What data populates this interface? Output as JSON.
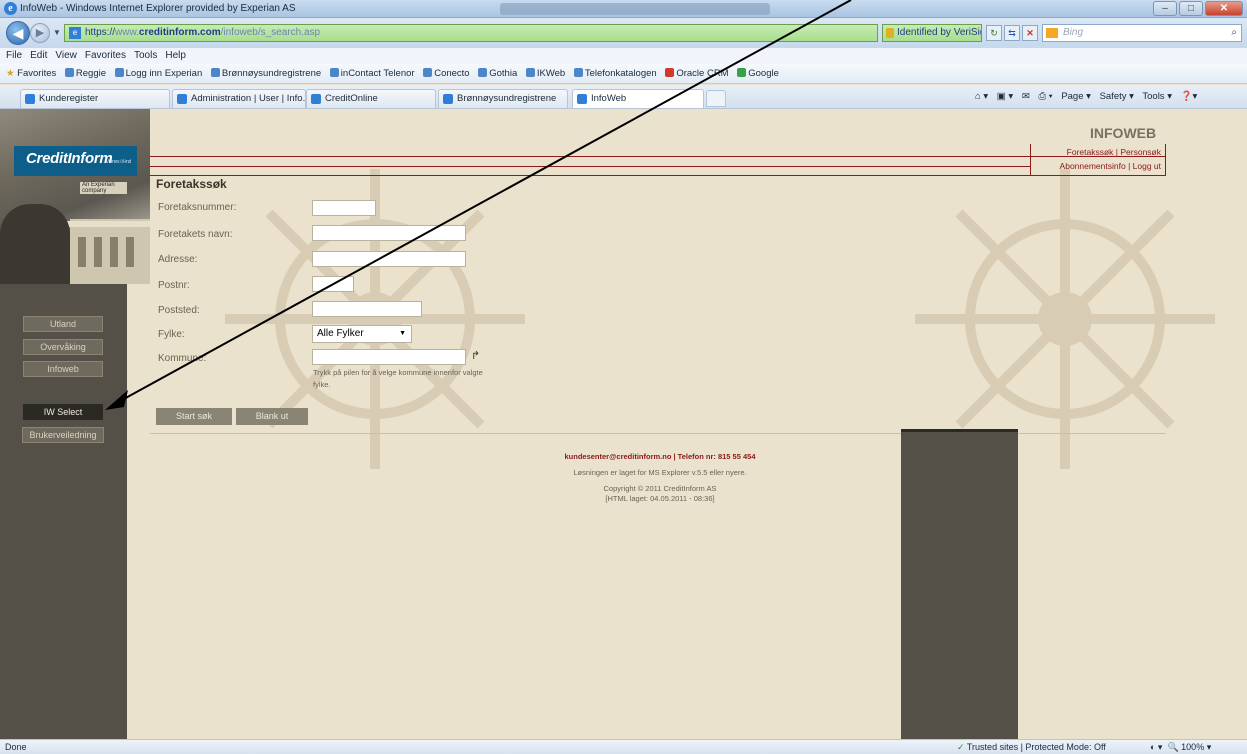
{
  "window": {
    "title": "InfoWeb - Windows Internet Explorer provided by Experian AS"
  },
  "address": {
    "url_prefix": "https://",
    "url_host_dim": "www.",
    "url_host": "creditinform.com",
    "url_path": "/infoweb/s_search.asp",
    "identity": "Identified by VeriSign",
    "search_placeholder": "Bing"
  },
  "menu": [
    "File",
    "Edit",
    "View",
    "Favorites",
    "Tools",
    "Help"
  ],
  "favorites": {
    "label": "Favorites",
    "items": [
      "Reggie",
      "Logg inn Experian",
      "Brønnøysundregistrene",
      "inContact Telenor",
      "Conecto",
      "Gothia",
      "IKWeb",
      "Telefonkatalogen",
      "Oracle CRM",
      "Google"
    ]
  },
  "tabs": [
    "Kunderegister",
    "Administration | User | Info...",
    "CreditOnline",
    "Brønnøysundregistrene",
    "InfoWeb"
  ],
  "command_bar": [
    "Page ▾",
    "Safety ▾",
    "Tools ▾"
  ],
  "brand": {
    "logo": "CreditInform",
    "tagline": "An Experian company",
    "site_title": "INFOWEB"
  },
  "top_links": {
    "line1": "Foretakssøk | Personsøk",
    "line2": "Abonnementsinfo | Logg ut"
  },
  "sidebar": {
    "items": [
      "Utland",
      "Overvåking",
      "Infoweb",
      "IW Select",
      "Brukerveiledning"
    ]
  },
  "form": {
    "heading": "Foretakssøk",
    "labels": {
      "foretaksnummer": "Foretaksnummer:",
      "navn": "Foretakets navn:",
      "adresse": "Adresse:",
      "postnr": "Postnr:",
      "poststed": "Poststed:",
      "fylke": "Fylke:",
      "kommune": "Kommune:"
    },
    "fylke_value": "Alle Fylker",
    "hint": "Trykk på pilen for å velge kommune innenfor valgte fylke.",
    "start_button": "Start søk",
    "blank_button": "Blank ut"
  },
  "footer": {
    "contact": "kundesenter@creditinform.no | Telefon nr: 815 55 454",
    "requirement": "Løsningen er laget for MS Explorer v.5.5 eller nyere.",
    "copyright": "Copyright © 2011 CreditInform AS",
    "built": "[HTML laget: 04.05.2011 - 08:36]"
  },
  "status": {
    "left": "Done",
    "zone": "Trusted sites | Protected Mode: Off",
    "zoom": "100%"
  },
  "colors": {
    "page_bg": "#eae2cc",
    "sidebar_bg": "#545047",
    "link_red": "#8b1a1a",
    "logo_blue": "#0d5f8a",
    "secure_green": "#a9de8e"
  }
}
